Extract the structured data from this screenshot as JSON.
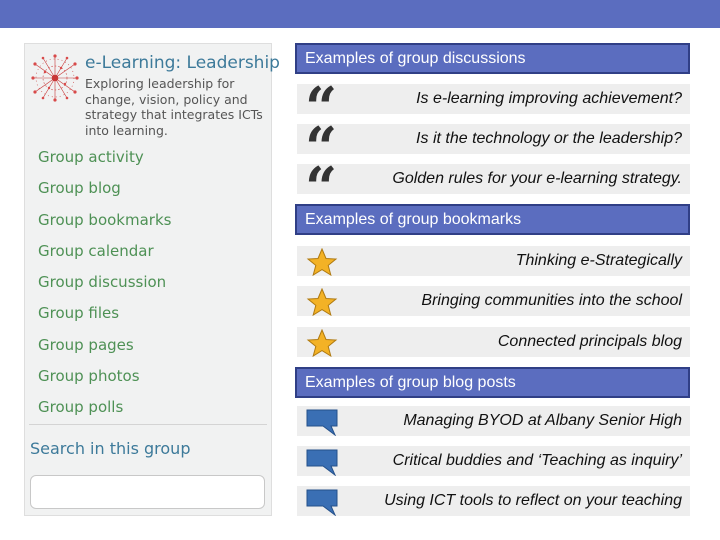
{
  "colors": {
    "accent": "#5b6dbf",
    "header_border": "#303f86",
    "menu_link": "#4e9155",
    "title_link": "#3d7a9a",
    "row_bg": "#eeeeee",
    "star": "#f3b226",
    "speech": "#3a6fb4"
  },
  "group": {
    "logo_icon": "network-logo-icon",
    "title": "e-Learning: Leadership",
    "description": "Exploring leadership for change, vision, policy and strategy that integrates ICTs into learning.",
    "menu": [
      "Group activity",
      "Group blog",
      "Group bookmarks",
      "Group calendar",
      "Group discussion",
      "Group files",
      "Group pages",
      "Group photos",
      "Group polls"
    ],
    "search_label": "Search in this group",
    "search_value": ""
  },
  "sections": {
    "discussions": {
      "header": "Examples of group discussions",
      "icon": "quote-icon",
      "items": [
        "Is e-learning improving achievement?",
        "Is it the technology or the leadership?",
        "Golden rules for your e-learning strategy."
      ]
    },
    "bookmarks": {
      "header": "Examples of group bookmarks",
      "icon": "star-icon",
      "items": [
        "Thinking e-Strategically",
        "Bringing communities into the school",
        "Connected principals blog"
      ]
    },
    "blog_posts": {
      "header": "Examples of group blog posts",
      "icon": "speech-bubble-icon",
      "items": [
        "Managing BYOD at Albany Senior High",
        "Critical buddies and ‘Teaching as inquiry’",
        "Using ICT tools to reflect on your teaching"
      ]
    }
  }
}
